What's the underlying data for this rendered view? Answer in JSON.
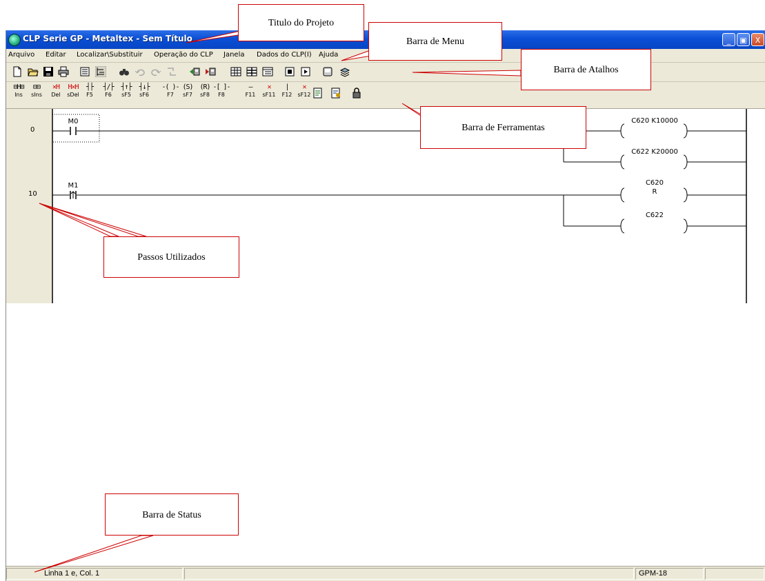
{
  "window": {
    "title": "CLP Serie GP - Metaltex - Sem Título",
    "controls": {
      "minimize": "_",
      "maximize": "▣",
      "close": "X"
    }
  },
  "menu": [
    "Arquivo",
    "Editar",
    "Localizar\\Substituir",
    "Operação do CLP",
    "Janela",
    "Dados do CLP(I)",
    "Ajuda"
  ],
  "toolbar_icons": [
    "new-file-icon",
    "open-folder-icon",
    "save-disk-icon",
    "print-icon",
    "monitor-icon",
    "ladder-view-icon",
    "find-icon",
    "undo-icon",
    "redo-icon",
    "replace-icon",
    "read-plc-icon",
    "write-plc-icon",
    "table-icon",
    "columns-icon",
    "list-icon",
    "stop-icon",
    "run-icon",
    "device-icon",
    "help-book-icon"
  ],
  "ladder_tools": [
    {
      "glyph": "⊟H⊟",
      "key": "Ins",
      "icon": "insert-line-icon"
    },
    {
      "glyph": "⊟⊟",
      "key": "sIns",
      "icon": "insert-column-icon"
    },
    {
      "glyph": "✕H",
      "key": "Del",
      "icon": "delete-line-icon",
      "red": true
    },
    {
      "glyph": "H✕H",
      "key": "sDel",
      "icon": "delete-column-icon",
      "red": true
    },
    {
      "glyph": "┤├",
      "key": "F5",
      "icon": "no-contact-icon"
    },
    {
      "glyph": "┤/├",
      "key": "F6",
      "icon": "nc-contact-icon"
    },
    {
      "glyph": "┤↑├",
      "key": "sF5",
      "icon": "rising-edge-contact-icon"
    },
    {
      "glyph": "┤↓├",
      "key": "sF6",
      "icon": "falling-edge-contact-icon"
    },
    {
      "glyph": "-( )-",
      "key": "F7",
      "icon": "coil-icon"
    },
    {
      "glyph": "(S)",
      "key": "sF7",
      "icon": "set-coil-icon"
    },
    {
      "glyph": "(R)",
      "key": "sF8",
      "icon": "reset-coil-icon"
    },
    {
      "glyph": "-[ ]-",
      "key": "F8",
      "icon": "function-block-icon"
    },
    {
      "glyph": "—",
      "key": "F11",
      "icon": "horizontal-line-icon"
    },
    {
      "glyph": "✕",
      "key": "sF11",
      "icon": "delete-horizontal-line-icon",
      "red": true
    },
    {
      "glyph": "|",
      "key": "F12",
      "icon": "vertical-line-icon"
    },
    {
      "glyph": "✕",
      "key": "sF12",
      "icon": "delete-vertical-line-icon",
      "red": true
    }
  ],
  "ladder_tool_extra_icons": [
    "compile-icon",
    "comment-icon",
    "lock-icon"
  ],
  "ladder": {
    "steps": [
      "0",
      "10"
    ],
    "contacts": [
      {
        "label": "M0"
      },
      {
        "label": "M1"
      }
    ],
    "coils": [
      {
        "line1": "C620 K10000",
        "line2": ""
      },
      {
        "line1": "C622 K20000",
        "line2": ""
      },
      {
        "line1": "C620",
        "line2": "R"
      },
      {
        "line1": "C622",
        "line2": ""
      }
    ]
  },
  "status": {
    "position": "Linha 1 e, Col. 1",
    "model": "GPM-18"
  },
  "callouts": {
    "titulo": "Titulo do Projeto",
    "menu": "Barra de Menu",
    "atalhos": "Barra de Atalhos",
    "ferramentas": "Barra de Ferramentas",
    "passos": "Passos Utilizados",
    "status": "Barra de Status"
  },
  "colors": {
    "titlebar": "#0a4fd6",
    "chrome": "#ece9d8",
    "callout_border": "#cc0000",
    "pen": "#000000"
  }
}
